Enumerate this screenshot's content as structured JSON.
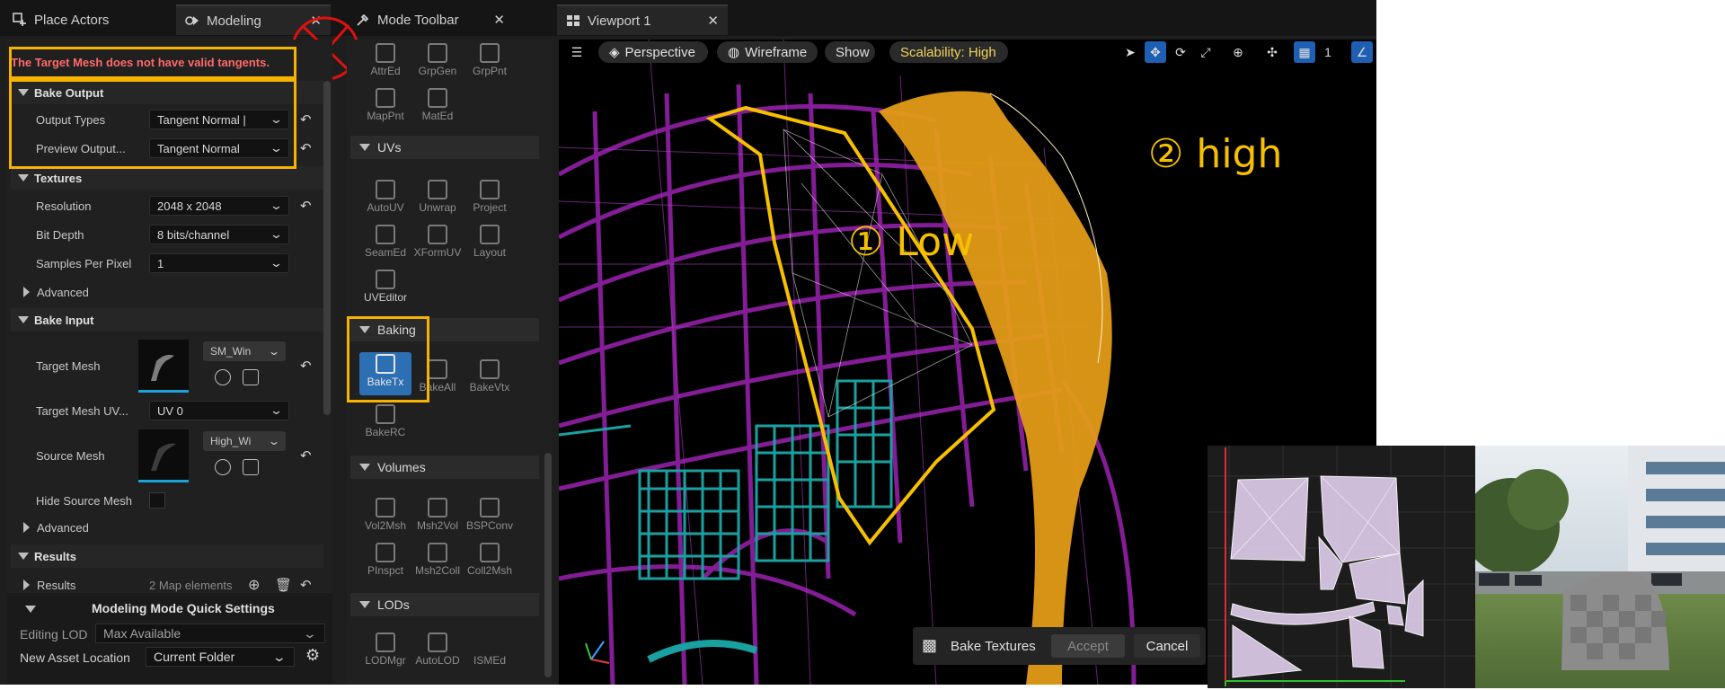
{
  "tabs": [
    {
      "label": "Place Actors",
      "icon": "place-actors-icon"
    },
    {
      "label": "Modeling",
      "icon": "modeling-icon"
    },
    {
      "label": "Mode Toolbar",
      "icon": "mode-toolbar-icon"
    },
    {
      "label": "Viewport 1",
      "icon": "viewport-icon"
    }
  ],
  "details": {
    "warning": "The Target Mesh does not have valid tangents.",
    "bake_output": {
      "title": "Bake Output",
      "output_types_label": "Output Types",
      "output_types_value": "Tangent Normal |",
      "preview_output_label": "Preview Output...",
      "preview_output_value": "Tangent Normal"
    },
    "textures": {
      "title": "Textures",
      "resolution_label": "Resolution",
      "resolution_value": "2048 x 2048",
      "bit_depth_label": "Bit Depth",
      "bit_depth_value": "8 bits/channel",
      "samples_label": "Samples Per Pixel",
      "samples_value": "1",
      "advanced_label": "Advanced"
    },
    "bake_input": {
      "title": "Bake Input",
      "target_mesh_label": "Target Mesh",
      "target_mesh_value": "SM_Win",
      "target_uv_label": "Target Mesh UV...",
      "target_uv_value": "UV 0",
      "source_mesh_label": "Source Mesh",
      "source_mesh_value": "High_Wi",
      "hide_source_label": "Hide Source Mesh",
      "advanced_label": "Advanced"
    },
    "results": {
      "title": "Results",
      "results_label": "Results",
      "results_value": "2 Map elements"
    }
  },
  "quick_settings": {
    "title": "Modeling Mode Quick Settings",
    "editing_lod_label": "Editing LOD",
    "editing_lod_value": "Max Available",
    "new_asset_label": "New Asset Location",
    "new_asset_value": "Current Folder"
  },
  "mode_toolbar": {
    "top_tools": [
      "AttrEd",
      "GrpGen",
      "GrpPnt",
      "MapPnt",
      "MatEd"
    ],
    "uvs": {
      "title": "UVs",
      "tools": [
        "AutoUV",
        "Unwrap",
        "Project",
        "SeamEd",
        "XFormUV",
        "Layout",
        "UVEditor"
      ]
    },
    "baking": {
      "title": "Baking",
      "tools": [
        "BakeTx",
        "BakeAll",
        "BakeVtx",
        "BakeRC"
      ]
    },
    "volumes": {
      "title": "Volumes",
      "tools": [
        "Vol2Msh",
        "Msh2Vol",
        "BSPConv",
        "PInspct",
        "Msh2Coll",
        "Coll2Msh"
      ]
    },
    "lods": {
      "title": "LODs",
      "tools": [
        "LODMgr",
        "AutoLOD",
        "ISMEd"
      ]
    }
  },
  "viewport": {
    "perspective": "Perspective",
    "wireframe": "Wireframe",
    "show": "Show",
    "scalability": "Scalability: High",
    "grid_value": "1"
  },
  "bake_bar": {
    "title": "Bake Textures",
    "accept": "Accept",
    "cancel": "Cancel"
  },
  "annotations": {
    "low": "① Low",
    "high": "② high"
  },
  "colors": {
    "highlight": "#f6b300",
    "warning": "#ff6a6a",
    "low_poly": "#8a1f9e",
    "cyan_mesh": "#1aa0a0",
    "high_poly": "#e39b17",
    "accent_blue": "#2d6fb3"
  }
}
